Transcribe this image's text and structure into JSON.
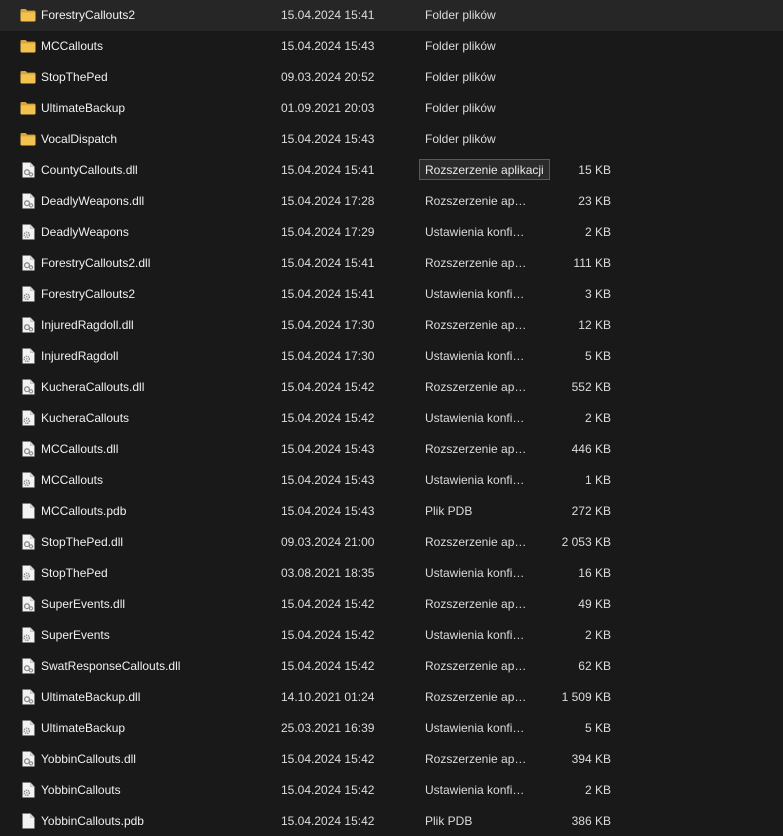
{
  "files": [
    {
      "name": "ForestryCallouts2",
      "date": "15.04.2024 15:41",
      "type": "Folder plików",
      "size": "",
      "icon": "folder-icon"
    },
    {
      "name": "MCCallouts",
      "date": "15.04.2024 15:43",
      "type": "Folder plików",
      "size": "",
      "icon": "folder-icon"
    },
    {
      "name": "StopThePed",
      "date": "09.03.2024 20:52",
      "type": "Folder plików",
      "size": "",
      "icon": "folder-icon"
    },
    {
      "name": "UltimateBackup",
      "date": "01.09.2021 20:03",
      "type": "Folder plików",
      "size": "",
      "icon": "folder-icon"
    },
    {
      "name": "VocalDispatch",
      "date": "15.04.2024 15:43",
      "type": "Folder plików",
      "size": "",
      "icon": "folder-icon"
    },
    {
      "name": "CountyCallouts.dll",
      "date": "15.04.2024 15:41",
      "type": "Rozszerzenie aplik...",
      "size": "15 KB",
      "icon": "dll-file-icon"
    },
    {
      "name": "DeadlyWeapons.dll",
      "date": "15.04.2024 17:28",
      "type": "Rozszerzenie aplik...",
      "size": "23 KB",
      "icon": "dll-file-icon"
    },
    {
      "name": "DeadlyWeapons",
      "date": "15.04.2024 17:29",
      "type": "Ustawienia konfig...",
      "size": "2 KB",
      "icon": "config-file-icon"
    },
    {
      "name": "ForestryCallouts2.dll",
      "date": "15.04.2024 15:41",
      "type": "Rozszerzenie aplik...",
      "size": "111 KB",
      "icon": "dll-file-icon"
    },
    {
      "name": "ForestryCallouts2",
      "date": "15.04.2024 15:41",
      "type": "Ustawienia konfig...",
      "size": "3 KB",
      "icon": "config-file-icon"
    },
    {
      "name": "InjuredRagdoll.dll",
      "date": "15.04.2024 17:30",
      "type": "Rozszerzenie aplik...",
      "size": "12 KB",
      "icon": "dll-file-icon"
    },
    {
      "name": "InjuredRagdoll",
      "date": "15.04.2024 17:30",
      "type": "Ustawienia konfig...",
      "size": "5 KB",
      "icon": "config-file-icon"
    },
    {
      "name": "KucheraCallouts.dll",
      "date": "15.04.2024 15:42",
      "type": "Rozszerzenie aplik...",
      "size": "552 KB",
      "icon": "dll-file-icon"
    },
    {
      "name": "KucheraCallouts",
      "date": "15.04.2024 15:42",
      "type": "Ustawienia konfig...",
      "size": "2 KB",
      "icon": "config-file-icon"
    },
    {
      "name": "MCCallouts.dll",
      "date": "15.04.2024 15:43",
      "type": "Rozszerzenie aplik...",
      "size": "446 KB",
      "icon": "dll-file-icon"
    },
    {
      "name": "MCCallouts",
      "date": "15.04.2024 15:43",
      "type": "Ustawienia konfig...",
      "size": "1 KB",
      "icon": "config-file-icon"
    },
    {
      "name": "MCCallouts.pdb",
      "date": "15.04.2024 15:43",
      "type": "Plik PDB",
      "size": "272 KB",
      "icon": "blank-file-icon"
    },
    {
      "name": "StopThePed.dll",
      "date": "09.03.2024 21:00",
      "type": "Rozszerzenie aplik...",
      "size": "2 053 KB",
      "icon": "dll-file-icon"
    },
    {
      "name": "StopThePed",
      "date": "03.08.2021 18:35",
      "type": "Ustawienia konfig...",
      "size": "16 KB",
      "icon": "config-file-icon"
    },
    {
      "name": "SuperEvents.dll",
      "date": "15.04.2024 15:42",
      "type": "Rozszerzenie aplik...",
      "size": "49 KB",
      "icon": "dll-file-icon"
    },
    {
      "name": "SuperEvents",
      "date": "15.04.2024 15:42",
      "type": "Ustawienia konfig...",
      "size": "2 KB",
      "icon": "config-file-icon"
    },
    {
      "name": "SwatResponseCallouts.dll",
      "date": "15.04.2024 15:42",
      "type": "Rozszerzenie aplik...",
      "size": "62 KB",
      "icon": "dll-file-icon"
    },
    {
      "name": "UltimateBackup.dll",
      "date": "14.10.2021 01:24",
      "type": "Rozszerzenie aplik...",
      "size": "1 509 KB",
      "icon": "dll-file-icon"
    },
    {
      "name": "UltimateBackup",
      "date": "25.03.2021 16:39",
      "type": "Ustawienia konfig...",
      "size": "5 KB",
      "icon": "config-file-icon"
    },
    {
      "name": "YobbinCallouts.dll",
      "date": "15.04.2024 15:42",
      "type": "Rozszerzenie aplik...",
      "size": "394 KB",
      "icon": "dll-file-icon"
    },
    {
      "name": "YobbinCallouts",
      "date": "15.04.2024 15:42",
      "type": "Ustawienia konfig...",
      "size": "2 KB",
      "icon": "config-file-icon"
    },
    {
      "name": "YobbinCallouts.pdb",
      "date": "15.04.2024 15:42",
      "type": "Plik PDB",
      "size": "386 KB",
      "icon": "blank-file-icon"
    }
  ],
  "tooltip": {
    "text": "Rozszerzenie aplikacji",
    "row_index": 5
  },
  "colors": {
    "background": "#191919",
    "folder": "#f2c14e",
    "folder_dark": "#d9a53a",
    "file": "#f3f3f3",
    "gear": "#8c8c8c"
  }
}
